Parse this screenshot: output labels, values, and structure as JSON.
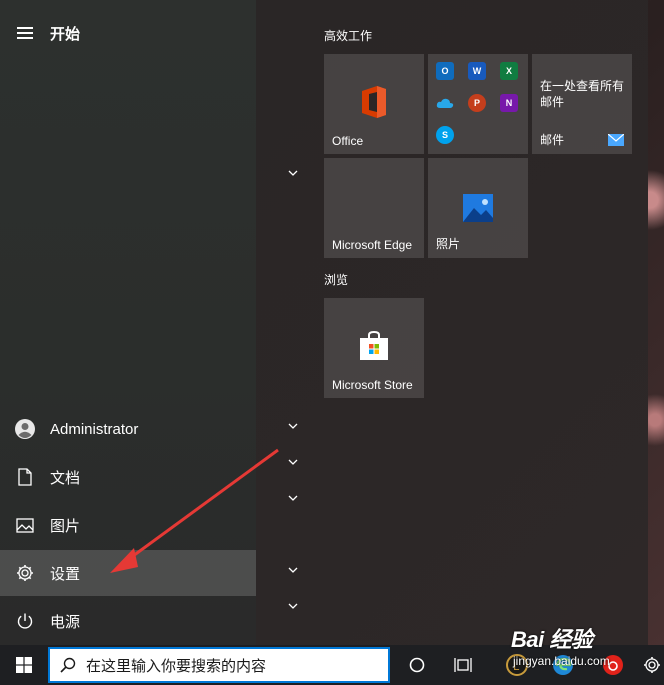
{
  "menu": {
    "title": "开始"
  },
  "nav": {
    "user": "Administrator",
    "documents": "文档",
    "pictures": "图片",
    "settings": "设置",
    "power": "电源"
  },
  "groups": {
    "productivity": "高效工作",
    "browse": "浏览"
  },
  "tiles": {
    "office": "Office",
    "mail_desc": "在一处查看所有邮件",
    "mail": "邮件",
    "edge": "Microsoft Edge",
    "photos": "照片",
    "store": "Microsoft Store"
  },
  "office_apps": [
    "outlook-icon",
    "word-icon",
    "excel-icon",
    "onedrive-icon",
    "powerpoint-icon",
    "onenote-icon",
    "skype-icon"
  ],
  "taskbar": {
    "search_placeholder": "在这里输入你要搜索的内容"
  },
  "watermark": {
    "brand": "Bai 经验",
    "url": "jingyan.baidu.com"
  },
  "colors": {
    "accent": "#0078d7",
    "annotation_arrow": "#e53935",
    "office_red": "#d83b01"
  }
}
